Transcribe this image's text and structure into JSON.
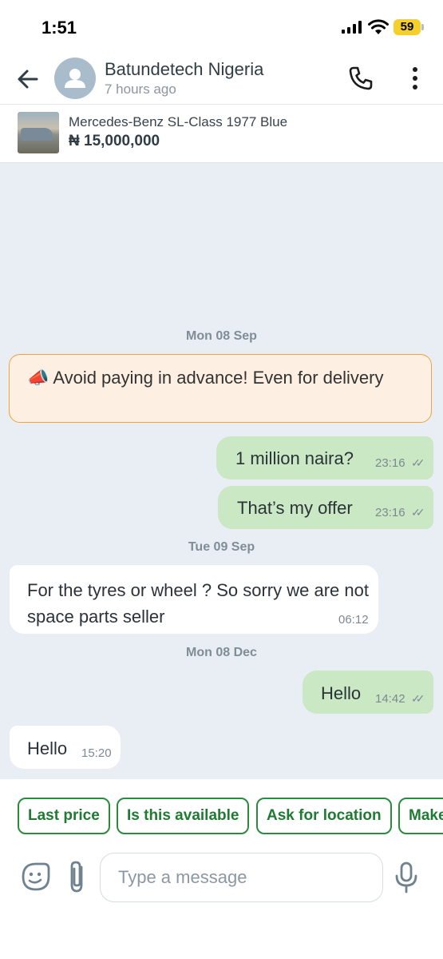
{
  "status_bar": {
    "time": "1:51",
    "battery": "59"
  },
  "header": {
    "name": "Batundetech Nigeria",
    "last_seen": "7 hours ago"
  },
  "listing": {
    "title": "Mercedes-Benz SL-Class 1977 Blue",
    "price": "₦ 15,000,000"
  },
  "dates": [
    "Mon 08 Sep",
    "Tue 09 Sep",
    "Mon 08 Dec"
  ],
  "warning": {
    "icon": "📣",
    "text": "Avoid paying in advance! Even for delivery"
  },
  "messages": [
    {
      "direction": "outgoing",
      "text": "1 million naira?",
      "time": "23:16",
      "read": true
    },
    {
      "direction": "outgoing",
      "text": "That’s my offer",
      "time": "23:16",
      "read": true
    },
    {
      "direction": "incoming",
      "text": "For the tyres or wheel ? So sorry we are not space parts seller",
      "time": "06:12"
    },
    {
      "direction": "outgoing",
      "text": "Hello",
      "time": "14:42",
      "read": true
    },
    {
      "direction": "incoming",
      "text": "Hello",
      "time": "15:20"
    }
  ],
  "quick_replies": [
    "Last price",
    "Is this available",
    "Ask for location",
    "Make"
  ],
  "composer": {
    "placeholder": "Type a message"
  },
  "colors": {
    "outgoing_bubble": "#c9e8c3",
    "incoming_bubble": "#ffffff",
    "chip_green": "#2b8a3e",
    "warning_border": "#f0a23d",
    "chat_background": "#e9eef4"
  }
}
